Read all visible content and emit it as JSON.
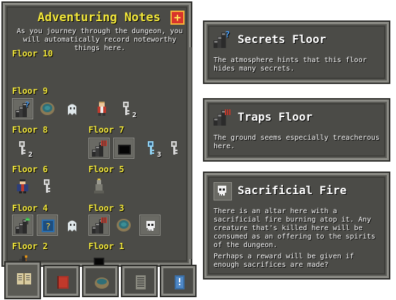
{
  "journal": {
    "title": "Adventuring Notes",
    "description": "As you journey through the dungeon, you will automatically record noteworthy things here.",
    "close_icon": "plus-icon",
    "floors": {
      "f10": "Floor 10",
      "f9": "Floor 9",
      "f8": "Floor 8",
      "f7": "Floor 7",
      "f6": "Floor 6",
      "f5": "Floor 5",
      "f4": "Floor 4",
      "f3": "Floor 3",
      "f2": "Floor 2",
      "f1": "Floor 1"
    },
    "counts": {
      "f9_key": "2",
      "f8_key": "2",
      "f7_key": "3"
    }
  },
  "tabs": [
    "journal-book-icon",
    "catalog-book-icon",
    "alchemy-pot-icon",
    "notes-page-icon",
    "guide-icon"
  ],
  "info_windows": [
    {
      "icon": "secret-stairs-icon",
      "title": "Secrets Floor",
      "text": "The atmosphere hints that this floor hides many secrets."
    },
    {
      "icon": "trap-stairs-icon",
      "title": "Traps Floor",
      "text": "The ground seems especially treacherous here."
    },
    {
      "icon": "skull-icon",
      "title": "Sacrificial Fire",
      "text": "There is an altar here with a sacrificial fire burning atop it. Any creature that's killed here will be consumed as an offering to the spirits of the dungeon.",
      "text2": "Perhaps a reward will be given if enough sacrifices are made?"
    }
  ],
  "colors": {
    "panel": "#4b4b47",
    "border": "#8c8c86",
    "title_yellow": "#f2e73a",
    "text_white": "#ffffff"
  }
}
